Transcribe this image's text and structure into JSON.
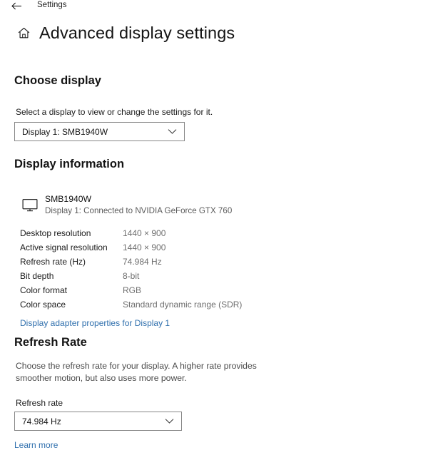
{
  "titlebar": {
    "back_icon": "back-arrow-icon",
    "label": "Settings"
  },
  "header": {
    "home_icon": "home-icon",
    "title": "Advanced display settings"
  },
  "choose_display": {
    "heading": "Choose display",
    "description": "Select a display to view or change the settings for it.",
    "dropdown": {
      "value": "Display 1: SMB1940W",
      "chevron_icon": "chevron-down-icon"
    }
  },
  "display_information": {
    "heading": "Display information",
    "monitor_icon": "monitor-icon",
    "monitor_name": "SMB1940W",
    "monitor_sub": "Display 1: Connected to NVIDIA GeForce GTX 760",
    "rows": [
      {
        "label": "Desktop resolution",
        "value": "1440 × 900"
      },
      {
        "label": "Active signal resolution",
        "value": "1440 × 900"
      },
      {
        "label": "Refresh rate (Hz)",
        "value": "74.984 Hz"
      },
      {
        "label": "Bit depth",
        "value": "8-bit"
      },
      {
        "label": "Color format",
        "value": "RGB"
      },
      {
        "label": "Color space",
        "value": "Standard dynamic range (SDR)"
      }
    ],
    "adapter_link": "Display adapter properties for Display 1"
  },
  "refresh_rate": {
    "heading": "Refresh Rate",
    "description": "Choose the refresh rate for your display. A higher rate provides smoother motion, but also uses more power.",
    "field_label": "Refresh rate",
    "dropdown": {
      "value": "74.984 Hz",
      "chevron_icon": "chevron-down-icon"
    },
    "learn_more": "Learn more"
  },
  "colors": {
    "link": "#2f6fad",
    "text": "#1b1b1b",
    "muted": "#6e6e6e",
    "border": "#868686",
    "background": "#ffffff"
  }
}
